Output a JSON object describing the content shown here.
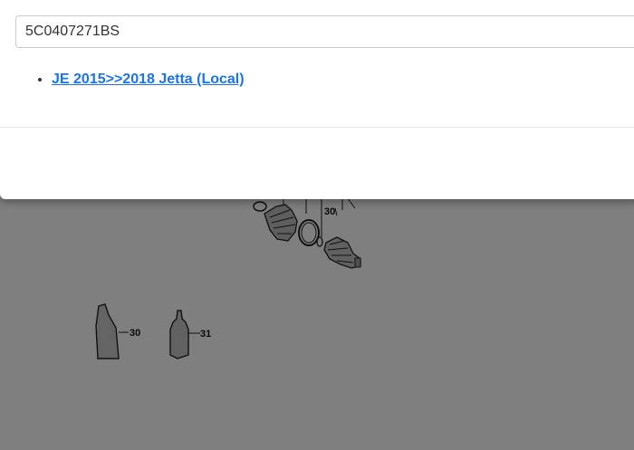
{
  "search": {
    "value": "5C0407271BS"
  },
  "results": [
    {
      "label": "JE 2015>>2018 Jetta (Local)"
    }
  ],
  "diagram": {
    "callouts": [
      "30",
      "30",
      "31"
    ]
  },
  "colors": {
    "link": "#1a73e8",
    "backdrop": "rgba(0,0,0,0.5)"
  }
}
